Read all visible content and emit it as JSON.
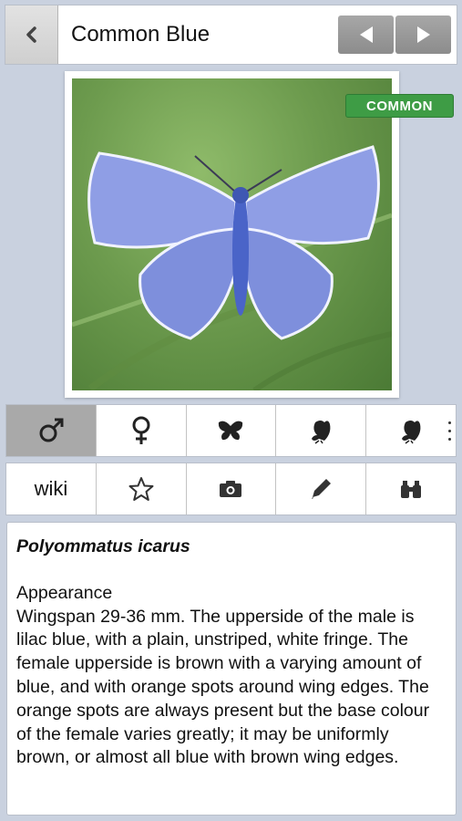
{
  "header": {
    "title": "Common Blue",
    "back_icon": "chevron-left-icon",
    "prev_icon": "triangle-left-icon",
    "next_icon": "triangle-right-icon"
  },
  "photo": {
    "subject": "butterfly-photo",
    "badge": "COMMON",
    "badge_color": "#3e9c45"
  },
  "tabs_row1": [
    {
      "icon": "male-icon",
      "selected": true
    },
    {
      "icon": "female-icon",
      "selected": false
    },
    {
      "icon": "butterfly-upperside-icon",
      "selected": false
    },
    {
      "icon": "butterfly-underside-icon",
      "selected": false
    },
    {
      "icon": "butterfly-underside-alt-icon",
      "selected": false
    }
  ],
  "tabs_row2": [
    {
      "label": "wiki"
    },
    {
      "icon": "star-icon"
    },
    {
      "icon": "camera-icon"
    },
    {
      "icon": "pencil-icon"
    },
    {
      "icon": "binoculars-icon"
    }
  ],
  "description": {
    "latin_name": "Polyommatus icarus",
    "section_title": "Appearance",
    "text": "Wingspan 29-36 mm. The upperside of the male is lilac blue, with a plain, unstriped, white fringe. The female upperside is brown with a varying amount of blue, and with orange spots around wing edges. The orange spots are always present but the base colour of the female varies greatly; it may be uniformly brown, or almost all blue with brown wing edges."
  }
}
